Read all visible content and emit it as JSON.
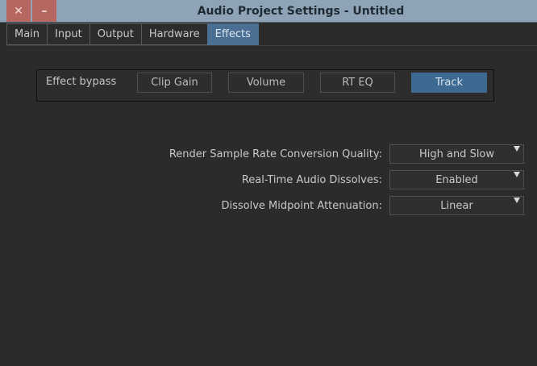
{
  "window": {
    "title": "Audio Project Settings - Untitled",
    "close_glyph": "✕",
    "minimize_glyph": "–"
  },
  "tabs": [
    {
      "label": "Main",
      "active": false
    },
    {
      "label": "Input",
      "active": false
    },
    {
      "label": "Output",
      "active": false
    },
    {
      "label": "Hardware",
      "active": false
    },
    {
      "label": "Effects",
      "active": true
    }
  ],
  "effect_bypass": {
    "label": "Effect bypass",
    "buttons": [
      {
        "label": "Clip Gain",
        "active": false
      },
      {
        "label": "Volume",
        "active": false
      },
      {
        "label": "RT EQ",
        "active": false
      },
      {
        "label": "Track",
        "active": true
      }
    ]
  },
  "settings": [
    {
      "label": "Render Sample Rate Conversion Quality:",
      "value": "High and Slow"
    },
    {
      "label": "Real-Time Audio Dissolves:",
      "value": "Enabled"
    },
    {
      "label": "Dissolve Midpoint Attenuation:",
      "value": "Linear"
    }
  ],
  "colors": {
    "titlebar": "#8ea4b6",
    "active_accent": "#4a6f93",
    "close_button": "#b66860"
  }
}
